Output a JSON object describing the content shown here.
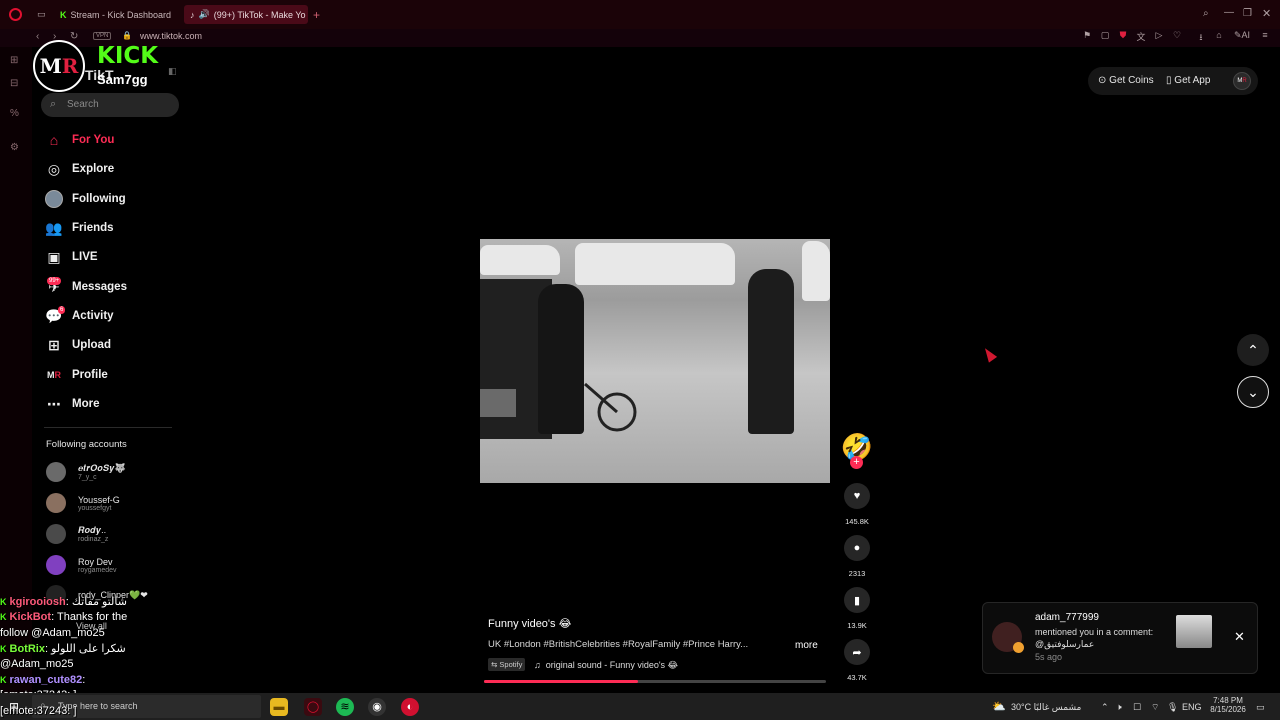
{
  "browser": {
    "tabs": [
      {
        "label": "Stream - Kick Dashboard",
        "active": false
      },
      {
        "label": "(99+) TikTok - Make Yo",
        "active": true
      }
    ],
    "vpn_label": "VPN",
    "url": "www.tiktok.com",
    "ai_label": "AI"
  },
  "overlay": {
    "logo_text": "MR",
    "brand": "KICK",
    "channel": "Sam7gg",
    "behind_text": "TikT"
  },
  "sidebar": {
    "search_placeholder": "Search",
    "nav": [
      {
        "label": "For You",
        "icon": "home-icon",
        "active": true
      },
      {
        "label": "Explore",
        "icon": "compass-icon"
      },
      {
        "label": "Following",
        "icon": "following-avatar-icon"
      },
      {
        "label": "Friends",
        "icon": "friends-icon"
      },
      {
        "label": "LIVE",
        "icon": "live-icon"
      },
      {
        "label": "Messages",
        "icon": "messages-icon",
        "badge": "99+"
      },
      {
        "label": "Activity",
        "icon": "activity-icon",
        "badge": "6"
      },
      {
        "label": "Upload",
        "icon": "upload-icon"
      },
      {
        "label": "Profile",
        "icon": "profile-icon"
      },
      {
        "label": "More",
        "icon": "more-icon"
      }
    ],
    "following_title": "Following accounts",
    "accounts": [
      {
        "name": "𝒆𝒕𝒓𝑶𝒐𝑺𝒚🐺",
        "username": "7_y_c"
      },
      {
        "name": "Youssef-G",
        "username": "youssefgyt"
      },
      {
        "name": "𝑹𝒐𝒅𝒚..",
        "username": "rodinaz_z"
      },
      {
        "name": "Roy Dev",
        "username": "roygamedev"
      },
      {
        "name": "rody_Clipper💚❤",
        "username": ""
      }
    ],
    "view_all": "View all"
  },
  "topright": {
    "get_coins": "Get Coins",
    "get_app": "Get App"
  },
  "video": {
    "title": "Funny video's 😂",
    "tags": "UK #London #BritishCelebrities #RoyalFamily #Prince Harry...",
    "more": "more",
    "spotify": "Spotify",
    "sound": "original sound - Funny video's 😂",
    "progress": 0.45,
    "likes": "145.8K",
    "comments": "2313",
    "saves": "13.9K",
    "shares": "43.7K"
  },
  "notification": {
    "user": "adam_777999",
    "message": "mentioned you in a comment: @عمارسلوفتيق",
    "time": "5s ago"
  },
  "chat": [
    {
      "user": "kgirooiosh",
      "text": ": شالتو مفاتك",
      "user_color": "#fe5a7a"
    },
    {
      "user": "KickBot",
      "text": ": Thanks for the",
      "user_color": "#fe5a7a"
    },
    {
      "user": "",
      "text": "follow @Adam_mo25",
      "user_color": "#ffffff"
    },
    {
      "user": "BotRix",
      "text": ": شكرا على اللولو",
      "user_color": "#7cfc3a"
    },
    {
      "user": "",
      "text": "@Adam_mo25",
      "user_color": "#ffffff"
    },
    {
      "user": "rawan_cute82",
      "text": ":",
      "user_color": "#b090ff"
    },
    {
      "user": "",
      "text": "[emote:37243: ]",
      "user_color": "#ffffff"
    },
    {
      "user": "",
      "text": "[emote:37243: ]",
      "user_color": "#ffffff"
    }
  ],
  "taskbar": {
    "search_placeholder": "Type here to search",
    "weather": "30°C  مشمس غالبًا",
    "lang": "ENG",
    "time": "7:48 PM",
    "date": "8/15/2026"
  },
  "colors": {
    "tiktok_red": "#fe2c55",
    "kick_green": "#53fc18",
    "opera_tabbar": "#1b0308"
  }
}
